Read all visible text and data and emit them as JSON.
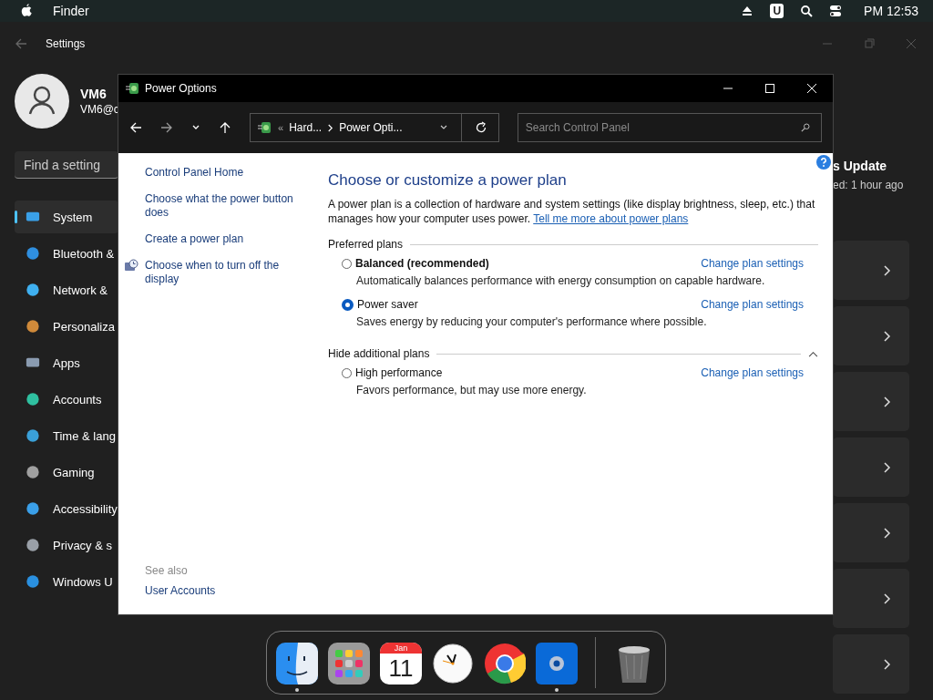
{
  "menu_bar": {
    "app_name": "Finder",
    "clock": "PM 12:53",
    "badge_letter": "U"
  },
  "settings": {
    "title": "Settings",
    "user": {
      "name": "VM6",
      "email": "VM6@c"
    },
    "search": {
      "placeholder": "Find a setting"
    },
    "nav": [
      {
        "label": "System",
        "selected": true
      },
      {
        "label": "Bluetooth &",
        "selected": false
      },
      {
        "label": "Network &",
        "selected": false
      },
      {
        "label": "Personaliza",
        "selected": false
      },
      {
        "label": "Apps",
        "selected": false
      },
      {
        "label": "Accounts",
        "selected": false
      },
      {
        "label": "Time & lang",
        "selected": false
      },
      {
        "label": "Gaming",
        "selected": false
      },
      {
        "label": "Accessibility",
        "selected": false
      },
      {
        "label": "Privacy & s",
        "selected": false
      },
      {
        "label": "Windows U",
        "selected": false
      }
    ],
    "update": {
      "title": "s Update",
      "subtitle": "ed: 1 hour ago"
    }
  },
  "power_window": {
    "title": "Power Options",
    "breadcrumb_overflow": "«",
    "breadcrumb": [
      "Hard...",
      "Power Opti..."
    ],
    "search": {
      "placeholder": "Search Control Panel"
    },
    "left_links": [
      {
        "label": "Control Panel Home",
        "icon": false
      },
      {
        "label": "Choose what the power button does",
        "icon": false
      },
      {
        "label": "Create a power plan",
        "icon": false
      },
      {
        "label": "Choose when to turn off the display",
        "icon": true
      }
    ],
    "see_also": {
      "heading": "See also",
      "links": [
        "User Accounts"
      ]
    },
    "heading": "Choose or customize a power plan",
    "description": "A power plan is a collection of hardware and system settings (like display brightness, sleep, etc.) that manages how your computer uses power.",
    "description_link": "Tell me more about power plans",
    "groups": [
      {
        "title": "Preferred plans",
        "plans": [
          {
            "name": "Balanced (recommended)",
            "emphasized": true,
            "selected": false,
            "description": "Automatically balances performance with energy consumption on capable hardware.",
            "link": "Change plan settings"
          },
          {
            "name": "Power saver",
            "emphasized": false,
            "selected": true,
            "description": "Saves energy by reducing your computer's performance where possible.",
            "link": "Change plan settings"
          }
        ]
      },
      {
        "title": "Hide additional plans",
        "expanded": true,
        "plans": [
          {
            "name": "High performance",
            "emphasized": false,
            "selected": false,
            "description": "Favors performance, but may use more energy.",
            "link": "Change plan settings"
          }
        ]
      }
    ]
  },
  "dock": [
    {
      "kind": "finder",
      "running": true
    },
    {
      "kind": "launchpad",
      "running": false
    },
    {
      "kind": "calendar",
      "running": false,
      "month": "Jan",
      "day": "11"
    },
    {
      "kind": "clock",
      "running": false
    },
    {
      "kind": "browser",
      "running": false
    },
    {
      "kind": "settings",
      "running": true
    },
    {
      "kind": "trash",
      "running": false
    }
  ]
}
